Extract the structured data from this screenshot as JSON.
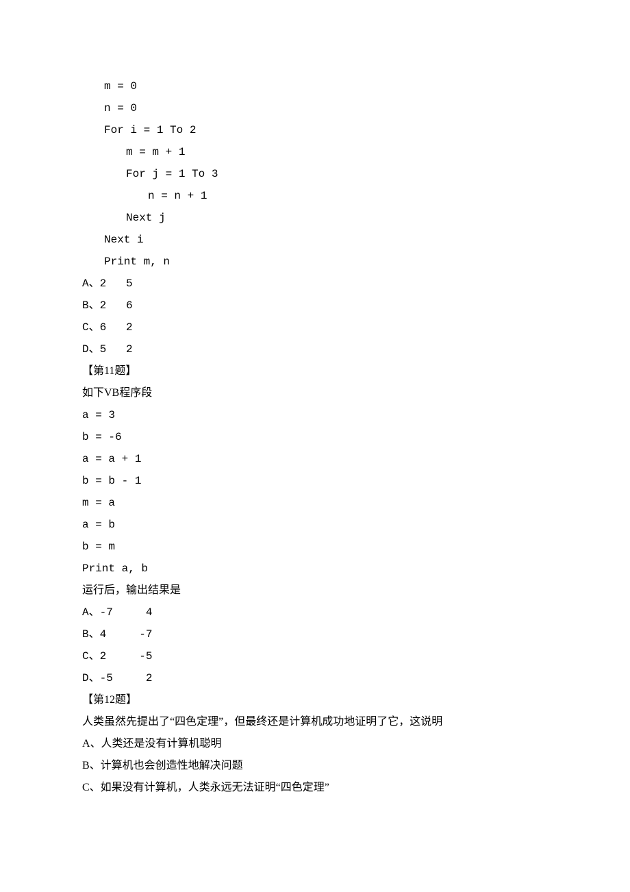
{
  "q10_code": {
    "l1": "m = 0",
    "l2": "n = 0",
    "l3": "For i = 1 To 2",
    "l4": "m = m + 1",
    "l5": "For j = 1 To 3",
    "l6": "n = n + 1",
    "l7": "Next j",
    "l8": "Next i",
    "l9": "Print m, n"
  },
  "q10_opts": {
    "A": "A、2   5",
    "B": "B、2   6",
    "C": "C、6   2",
    "D": "D、5   2"
  },
  "q11": {
    "header": "【第11题】",
    "stem": "如下VB程序段",
    "c1": "a = 3",
    "c2": "b = -6",
    "c3": "a = a + 1",
    "c4": "b = b - 1",
    "c5": "m = a",
    "c6": "a = b",
    "c7": "b = m",
    "c8": "Print a, b",
    "prompt": "运行后，输出结果是",
    "A": "A、-7     4",
    "B": "B、4     -7",
    "C": "C、2     -5",
    "D": "D、-5     2"
  },
  "q12": {
    "header": "【第12题】",
    "stem": "人类虽然先提出了“四色定理”，但最终还是计算机成功地证明了它，这说明",
    "A": "A、人类还是没有计算机聪明",
    "B": "B、计算机也会创造性地解决问题",
    "C": "C、如果没有计算机，人类永远无法证明“四色定理”"
  }
}
